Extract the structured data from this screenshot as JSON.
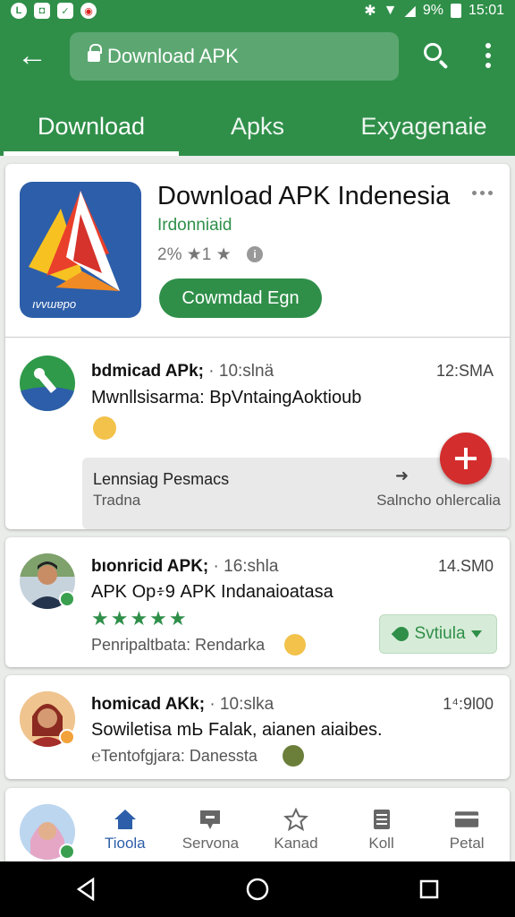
{
  "statusbar": {
    "battery": "9%",
    "time": "15:01"
  },
  "toolbar": {
    "url": "Download APK"
  },
  "tabs": [
    {
      "label": "Download"
    },
    {
      "label": "Apks"
    },
    {
      "label": "Exyagenaie"
    }
  ],
  "app": {
    "title": "Download APK Indenesia",
    "developer": "Irdonniaid",
    "rating": "2% ★1 ★",
    "button": "Cowmdad Egn",
    "icon_text": "ıvvɯɐpo"
  },
  "posts": [
    {
      "name": "bdmicad APk;",
      "handle": "· 10:slnä",
      "time": "12:SMA",
      "text": "Mwnllsisarma: BpVntaingAoktioub",
      "panel_title": "Lennsiag Pesmacs",
      "panel_sub": "Tradna",
      "panel_right": "Salncho ohlercalia"
    },
    {
      "name": "bıonricid APK;",
      "handle": "· 16:shla",
      "time": "14.SM0",
      "text": "APK Op፥9 APK Indanaioatasa",
      "stars": "★★★★★",
      "sub": "Penripaltbata: Rendarka",
      "chip": "Svtiula"
    },
    {
      "name": "homicad AKk;",
      "handle": "· 10:slka",
      "time": "1⁴:9l00",
      "text": "Sowiletisa mЬ Falak, aianen aiaibes.",
      "sub": "℮Tentofgjara: Danessta"
    }
  ],
  "bottom_nav": [
    {
      "label": "Tioola",
      "icon": "home-icon"
    },
    {
      "label": "Servona",
      "icon": "chat-bubble-icon"
    },
    {
      "label": "Kanad",
      "icon": "star-outline-icon"
    },
    {
      "label": "Koll",
      "icon": "document-icon"
    },
    {
      "label": "Petal",
      "icon": "card-icon"
    }
  ],
  "colors": {
    "primary": "#2f8f49",
    "accent": "#d42d2d",
    "nav_active": "#2d5ea9"
  }
}
